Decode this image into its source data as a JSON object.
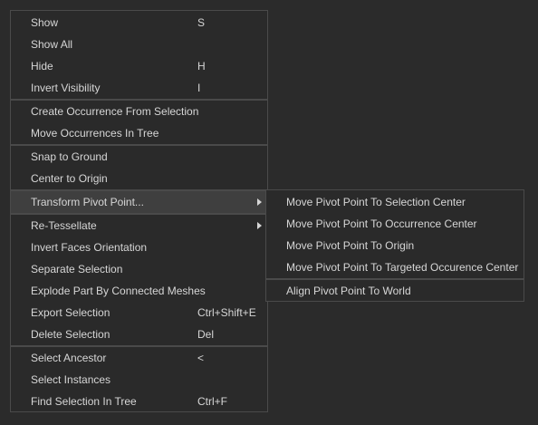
{
  "main_menu": {
    "items": [
      {
        "label": "Show",
        "shortcut": "S"
      },
      {
        "label": "Show All",
        "shortcut": ""
      },
      {
        "label": "Hide",
        "shortcut": "H"
      },
      {
        "label": "Invert Visibility",
        "shortcut": "I"
      },
      {
        "label": "Create Occurrence From Selection",
        "shortcut": ""
      },
      {
        "label": "Move Occurrences In Tree",
        "shortcut": ""
      },
      {
        "label": "Snap to Ground",
        "shortcut": ""
      },
      {
        "label": "Center to Origin",
        "shortcut": ""
      },
      {
        "label": "Transform Pivot Point...",
        "shortcut": "",
        "submenu": true,
        "highlighted": true
      },
      {
        "label": "Re-Tessellate",
        "shortcut": "",
        "submenu": true
      },
      {
        "label": "Invert Faces Orientation",
        "shortcut": ""
      },
      {
        "label": "Separate Selection",
        "shortcut": ""
      },
      {
        "label": "Explode Part By Connected Meshes",
        "shortcut": ""
      },
      {
        "label": "Export Selection",
        "shortcut": "Ctrl+Shift+E"
      },
      {
        "label": "Delete Selection",
        "shortcut": "Del"
      },
      {
        "label": "Select Ancestor",
        "shortcut": "<"
      },
      {
        "label": "Select Instances",
        "shortcut": ""
      },
      {
        "label": "Find Selection In Tree",
        "shortcut": "Ctrl+F"
      }
    ]
  },
  "sub_menu": {
    "items": [
      {
        "label": "Move Pivot Point To Selection Center"
      },
      {
        "label": "Move Pivot Point To Occurrence Center"
      },
      {
        "label": "Move Pivot Point To Origin"
      },
      {
        "label": "Move Pivot Point To Targeted Occurence Center"
      },
      {
        "label": "Align Pivot Point To World"
      }
    ]
  },
  "colors": {
    "background": "#2b2b2b",
    "menu_bg": "#2a2a2a",
    "border": "#4a4a4a",
    "text": "#d6d6d6",
    "highlight": "#3f3f3f"
  }
}
